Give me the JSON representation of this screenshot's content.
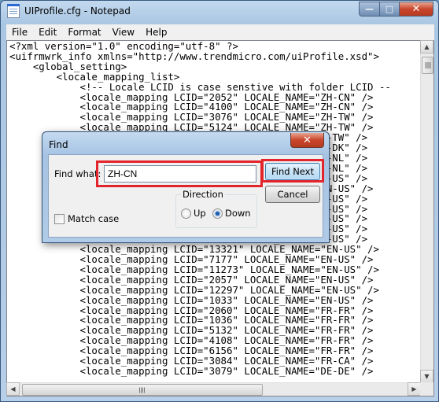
{
  "window": {
    "title": "UIProfile.cfg - Notepad",
    "icon": "notepad-icon",
    "caption_buttons": {
      "minimize": "—",
      "maximize": "□",
      "close": "✕"
    }
  },
  "menu": [
    "File",
    "Edit",
    "Format",
    "View",
    "Help"
  ],
  "editor": {
    "lines": [
      "<?xml version=\"1.0\" encoding=\"utf-8\" ?>",
      "<uifrmwrk_info xmlns=\"http://www.trendmicro.com/uiProfile.xsd\">",
      "    <global_setting>",
      "        <locale_mapping_list>",
      "            <!-- Locale LCID is case senstive with folder LCID --",
      "            <locale_mapping LCID=\"2052\" LOCALE_NAME=\"ZH-CN\" />",
      "            <locale_mapping LCID=\"4100\" LOCALE_NAME=\"ZH-CN\" />",
      "            <locale_mapping LCID=\"3076\" LOCALE_NAME=\"ZH-TW\" />",
      "            <locale_mapping LCID=\"5124\" LOCALE_NAME=\"ZH-TW\" />",
      "                                       LOCALE_NAME=\"ZH-TW\" />",
      "                                       LOCALE_NAME=\"DA-DK\" />",
      "                                       LOCALE_NAME=\"NL-NL\" />",
      "                                       LOCALE_NAME=\"NL-NL\" />",
      "                                       LOCALE_NAME=\"EN-US\" />",
      "                                        LOCALE_NAME=\"EN-US\" />",
      "                                       LOCALE_NAME=\"EN-US\" />",
      "                                       LOCALE_NAME=\"EN-US\" />",
      "                                       LOCALE_NAME=\"EN-US\" />",
      "                                       LOCALE_NAME=\"EN-US\" />",
      "                                       LOCALE_NAME=\"EN-US\" />",
      "            <locale_mapping LCID=\"13321\" LOCALE_NAME=\"EN-US\" />",
      "            <locale_mapping LCID=\"7177\" LOCALE_NAME=\"EN-US\" />",
      "            <locale_mapping LCID=\"11273\" LOCALE_NAME=\"EN-US\" />",
      "            <locale_mapping LCID=\"2057\" LOCALE_NAME=\"EN-US\" />",
      "            <locale_mapping LCID=\"12297\" LOCALE_NAME=\"EN-US\" />",
      "            <locale_mapping LCID=\"1033\" LOCALE_NAME=\"EN-US\" />",
      "            <locale_mapping LCID=\"2060\" LOCALE_NAME=\"FR-FR\" />",
      "            <locale_mapping LCID=\"1036\" LOCALE_NAME=\"FR-FR\" />",
      "            <locale_mapping LCID=\"5132\" LOCALE_NAME=\"FR-FR\" />",
      "            <locale_mapping LCID=\"4108\" LOCALE_NAME=\"FR-FR\" />",
      "            <locale_mapping LCID=\"6156\" LOCALE_NAME=\"FR-FR\" />",
      "            <locale_mapping LCID=\"3084\" LOCALE_NAME=\"FR-CA\" />",
      "            <locale_mapping LCID=\"3079\" LOCALE_NAME=\"DE-DE\" />"
    ]
  },
  "find_dialog": {
    "title": "Find",
    "find_what_label": "Find what:",
    "find_what_value": "ZH-CN",
    "find_next_label": "Find Next",
    "cancel_label": "Cancel",
    "direction_label": "Direction",
    "up_label": "Up",
    "down_label": "Down",
    "direction_selected": "Down",
    "match_case_label": "Match case",
    "match_case_checked": false,
    "close_glyph": "✕",
    "highlight_color": "#e2242c"
  },
  "scrollbar_glyphs": {
    "up": "▲",
    "down": "▼",
    "left": "◀",
    "right": "▶"
  }
}
